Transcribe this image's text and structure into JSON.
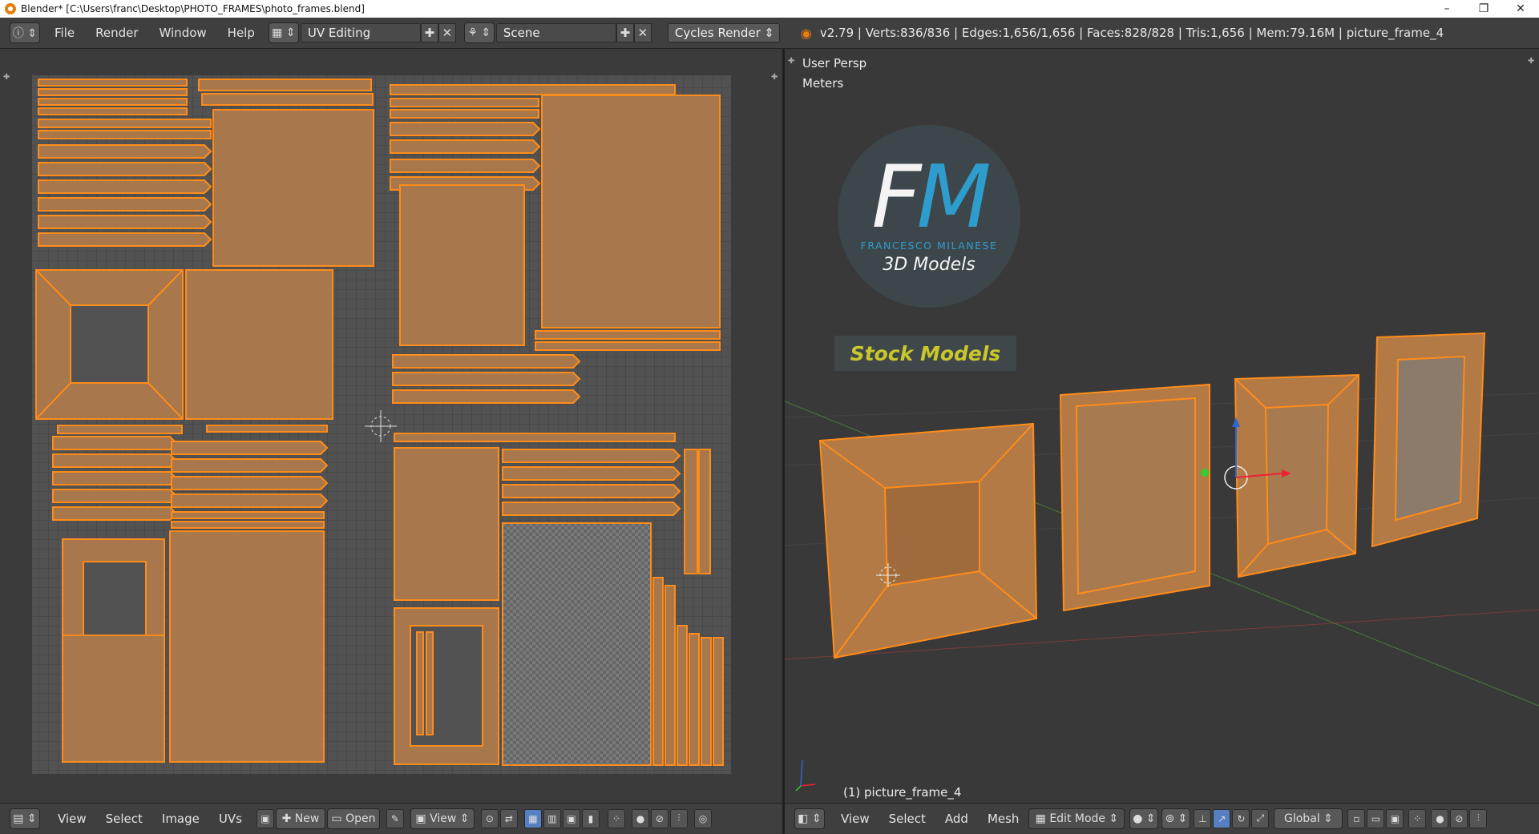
{
  "window": {
    "title": "Blender* [C:\\Users\\franc\\Desktop\\PHOTO_FRAMES\\photo_frames.blend]",
    "controls": [
      "–",
      "❐",
      "✕"
    ]
  },
  "topbar": {
    "menus": [
      "File",
      "Render",
      "Window",
      "Help"
    ],
    "layout": "UV Editing",
    "scene": "Scene",
    "engine": "Cycles Render",
    "stats": "v2.79 | Verts:836/836 | Edges:1,656/1,656 | Faces:828/828 | Tris:1,656 | Mem:79.16M | picture_frame_4"
  },
  "uv_bottombar": {
    "menus": [
      "View",
      "Select",
      "Image",
      "UVs"
    ],
    "new_label": "New",
    "open_label": "Open",
    "view_label": "View"
  },
  "viewport": {
    "persp_label": "User Persp",
    "units_label": "Meters",
    "object_label": "(1) picture_frame_4",
    "watermark": {
      "letter_f": "F",
      "letter_m": "M",
      "name": "FRANCESCO MILANESE",
      "subtitle": "3D Models",
      "stock": "Stock Models"
    }
  },
  "vp_bottombar": {
    "menus": [
      "View",
      "Select",
      "Add",
      "Mesh"
    ],
    "mode": "Edit Mode",
    "orientation": "Global"
  },
  "colors": {
    "uv_fill": "#b07a4a",
    "uv_edge": "#ff8c1a",
    "accent_blue": "#2ea3d6",
    "stock_yellow": "#c9c72c"
  }
}
